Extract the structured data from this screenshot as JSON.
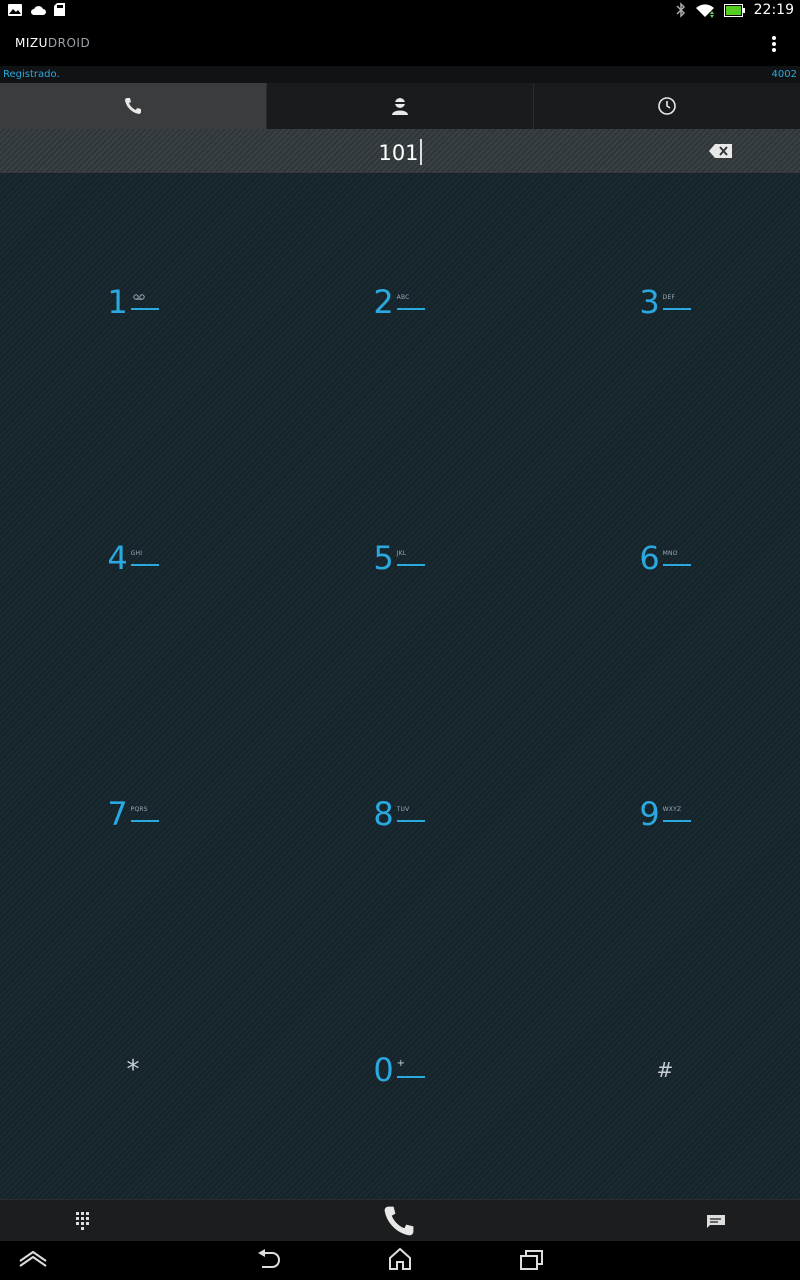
{
  "status_bar": {
    "time": "22:19",
    "left_icons": [
      "gallery-icon",
      "cloud-icon",
      "sd-card-icon"
    ],
    "right_icons": [
      "bluetooth-icon",
      "wifi-icon",
      "battery-icon"
    ]
  },
  "app": {
    "logo_part1": "MIZU",
    "logo_part2": "DROID",
    "registration_status": "Registrado.",
    "account_number": "4002"
  },
  "tabs": [
    {
      "name": "dialer",
      "icon": "phone-icon",
      "active": true
    },
    {
      "name": "contacts",
      "icon": "contact-icon",
      "active": false
    },
    {
      "name": "history",
      "icon": "clock-icon",
      "active": false
    }
  ],
  "dial_input": {
    "value": "101"
  },
  "keypad": [
    {
      "digit": "1",
      "letters": "voicemail"
    },
    {
      "digit": "2",
      "letters": "ABC"
    },
    {
      "digit": "3",
      "letters": "DEF"
    },
    {
      "digit": "4",
      "letters": "GHI"
    },
    {
      "digit": "5",
      "letters": "JKL"
    },
    {
      "digit": "6",
      "letters": "MNO"
    },
    {
      "digit": "7",
      "letters": "PQRS"
    },
    {
      "digit": "8",
      "letters": "TUV"
    },
    {
      "digit": "9",
      "letters": "WXYZ"
    },
    {
      "digit": "*",
      "letters": ""
    },
    {
      "digit": "0",
      "letters": "+"
    },
    {
      "digit": "#",
      "letters": ""
    }
  ],
  "bottom_bar": [
    "keypad-icon",
    "call-icon",
    "message-icon"
  ],
  "nav_bar": [
    "home-up-icon",
    "back-icon",
    "home-icon",
    "recents-icon"
  ],
  "colors": {
    "accent": "#2aa9e0",
    "pad_bg": "#1b2a31"
  }
}
